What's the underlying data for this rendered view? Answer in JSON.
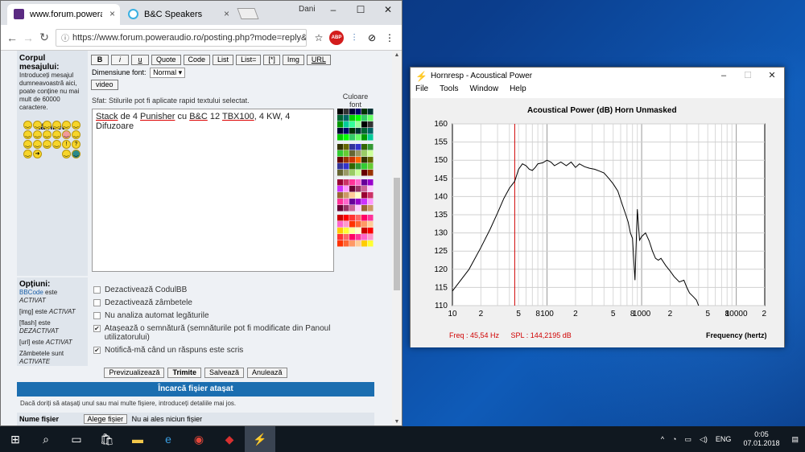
{
  "browser": {
    "user": "Dani",
    "tabs": [
      {
        "label": "www.forum.poweraudio.r",
        "close": "×"
      },
      {
        "label": "B&C Speakers",
        "close": "×"
      }
    ],
    "url": "https://www.forum.poweraudio.ro/posting.php?mode=reply&f...",
    "window_controls": [
      "–",
      "☐",
      "✕"
    ]
  },
  "forum": {
    "body_heading": "Corpul mesajului:",
    "body_help": "Introduceți mesajul dumneavoastră aici, poate conține nu mai mult de 60000 caractere.",
    "smileys_heading": "Zâmbete",
    "format_buttons": [
      "B",
      "i",
      "u",
      "Quote",
      "Code",
      "List",
      "List=",
      "[*]",
      "Img",
      "URL"
    ],
    "font_size_label": "Dimensiune font:",
    "font_size_value": "Normal",
    "video_button": "video",
    "hint": "Sfat: Stilurile pot fi aplicate rapid textului selectat.",
    "color_heading": "Culoare font",
    "message_parts": [
      "Stack",
      " de 4 ",
      "Punisher",
      " cu ",
      "B&C",
      " 12 ",
      "TBX100",
      ", 4 KW, 4 Difuzoare"
    ],
    "options_heading": "Opțiuni:",
    "options_left": [
      {
        "key": "BBCode",
        "rest": " este ",
        "state": "ACTIVAT"
      },
      {
        "key": "[img]",
        "rest": " este ",
        "state": "ACTIVAT"
      },
      {
        "key": "[flash]",
        "rest": " este ",
        "state": "DEZACTIVAT"
      },
      {
        "key": "[url]",
        "rest": " este ",
        "state": "ACTIVAT"
      },
      {
        "key": "Zâmbetele",
        "rest": " sunt ",
        "state": "ACTIVATE"
      }
    ],
    "checkboxes": [
      {
        "label": "Dezactivează CodulBB",
        "checked": ""
      },
      {
        "label": "Dezactivează zâmbetele",
        "checked": ""
      },
      {
        "label": "Nu analiza automat legăturile",
        "checked": ""
      },
      {
        "label": "Atașează o semnătură (semnăturile pot fi modificate din Panoul utilizatorului)",
        "checked": "✔"
      },
      {
        "label": "Notifică-mă când un răspuns este scris",
        "checked": "✔"
      }
    ],
    "actions": [
      "Previzualizează",
      "Trimite",
      "Salvează",
      "Anulează"
    ],
    "attach_heading": "Încarcă fișier atașat",
    "attach_note": "Dacă doriți să atașați unul sau mai multe fișiere, introduceți detaliile mai jos.",
    "attach_field": "Nume fișier",
    "browse_button": "Alege fișier",
    "no_file": "Nu ai ales niciun fișier"
  },
  "hornresp": {
    "title": "Hornresp - Acoustical Power",
    "menu": [
      "File",
      "Tools",
      "Window",
      "Help"
    ],
    "freq_readout": "Freq : 45,54 Hz",
    "spl_readout": "SPL : 144,2195 dB",
    "window_controls": [
      "–",
      "☐",
      "✕"
    ]
  },
  "chart_data": {
    "type": "line",
    "title": "Acoustical Power (dB)   Horn   Unmasked",
    "xlabel": "Frequency (hertz)",
    "xscale": "log",
    "xlim": [
      10,
      20000
    ],
    "ylim": [
      110,
      160
    ],
    "x_tick_labels": [
      "10",
      "2",
      "5",
      "8",
      "100",
      "2",
      "5",
      "8",
      "1000",
      "2",
      "5",
      "8",
      "10000",
      "2"
    ],
    "y_ticks": [
      110,
      115,
      120,
      125,
      130,
      135,
      140,
      145,
      150,
      155,
      160
    ],
    "marker_x": 45.54,
    "marker_color": "#d00000",
    "series": [
      {
        "x": [
          10,
          15,
          20,
          25,
          30,
          35,
          40,
          45.54,
          50,
          55,
          60,
          65,
          70,
          75,
          80,
          90,
          100,
          110,
          120,
          140,
          160,
          180,
          200,
          220,
          250,
          280,
          320,
          360,
          400,
          450,
          500,
          560,
          620,
          680,
          720,
          760,
          800,
          850,
          900,
          950,
          1000,
          1100,
          1200,
          1300,
          1400,
          1500,
          1600,
          1800,
          2000,
          2200,
          2500,
          2800,
          3000,
          3200,
          3500,
          3800,
          4000
        ],
        "y": [
          114,
          120,
          126,
          131,
          135.5,
          139.5,
          142.3,
          144.2,
          147.5,
          149,
          148.5,
          147.5,
          147.2,
          148,
          149,
          149.3,
          150,
          149.5,
          148.5,
          149.5,
          148.5,
          149.5,
          148,
          149,
          148.2,
          147.8,
          147.5,
          147,
          146.5,
          145,
          143.5,
          141.5,
          138,
          135,
          133,
          130,
          128.5,
          117,
          136.5,
          128,
          129,
          130,
          127.8,
          125,
          123,
          122.5,
          123,
          121,
          119.5,
          118,
          116.5,
          117,
          115,
          113.5,
          112.5,
          111.5,
          110
        ]
      }
    ]
  },
  "taskbar": {
    "lang": "ENG",
    "time": "0:05",
    "date": "07.01.2018"
  }
}
